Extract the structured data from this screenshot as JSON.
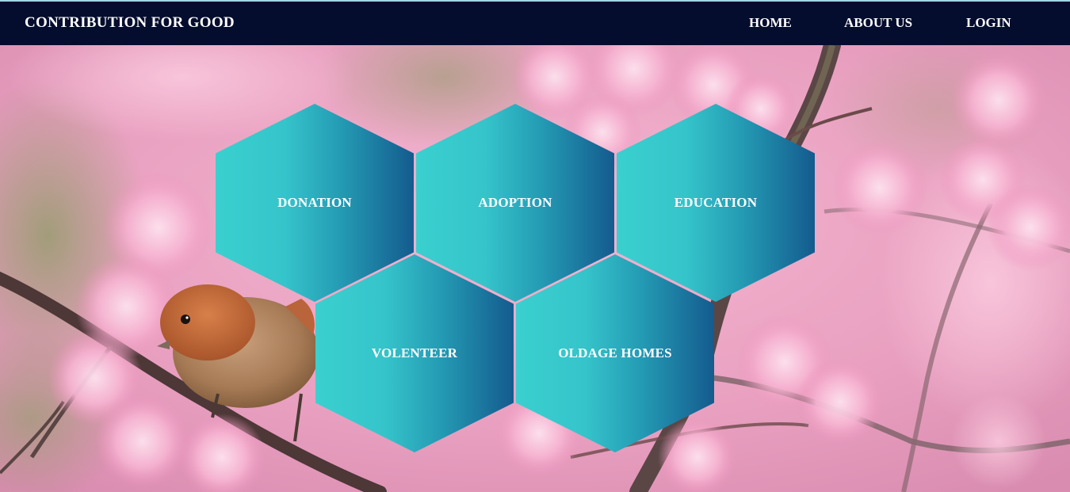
{
  "header": {
    "brand": "CONTRIBUTION FOR GOOD",
    "nav": {
      "home": "HOME",
      "about": "ABOUT US",
      "login": "LOGIN"
    }
  },
  "tiles": {
    "donation": "DONATION",
    "adoption": "ADOPTION",
    "education": "EDUCATION",
    "volunteer": "VOLENTEER",
    "oldage": "OLDAGE HOMES"
  },
  "colors": {
    "navbar": "#050d2e",
    "hex_light": "#3ad0cf",
    "hex_dark": "#145b8e",
    "blossom": "#f2a9c9"
  }
}
